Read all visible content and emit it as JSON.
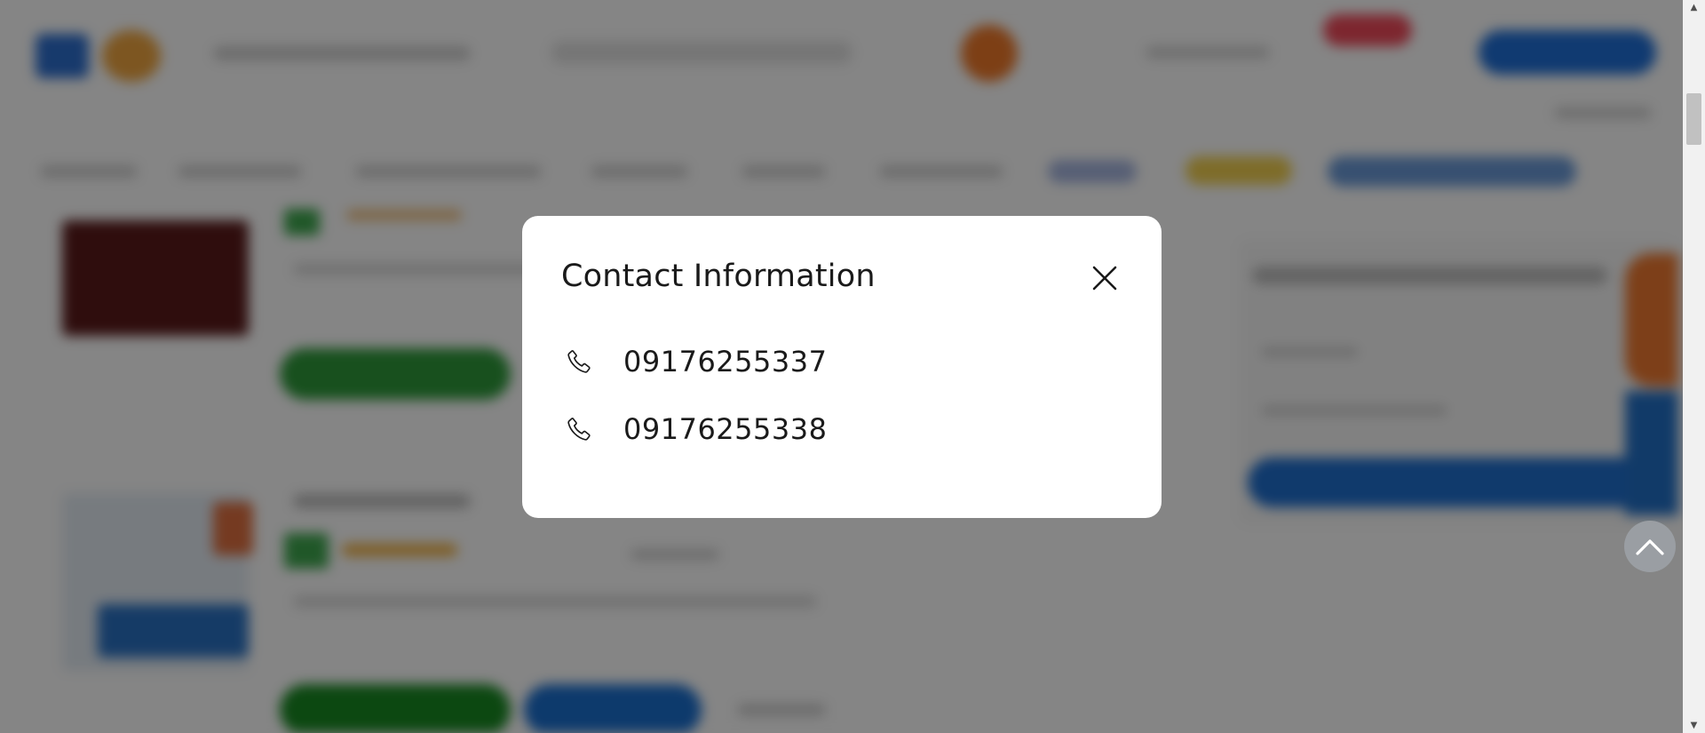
{
  "modal": {
    "title": "Contact Information",
    "close_icon": "close-icon",
    "phones": [
      {
        "number": "09176255337",
        "icon": "phone-icon"
      },
      {
        "number": "09176255338",
        "icon": "phone-icon"
      }
    ]
  },
  "scroll_to_top": {
    "icon": "chevron-up-icon"
  },
  "scrollbar": {
    "up_icon": "triangle-up-icon",
    "down_icon": "triangle-down-icon"
  },
  "colors": {
    "overlay": "#000000",
    "modal_bg": "#ffffff",
    "text": "#1a1a1a",
    "accent_blue": "#1f6fbf",
    "accent_green": "#1a8a2a",
    "accent_orange": "#e8742a",
    "accent_red": "#e23a4a"
  }
}
